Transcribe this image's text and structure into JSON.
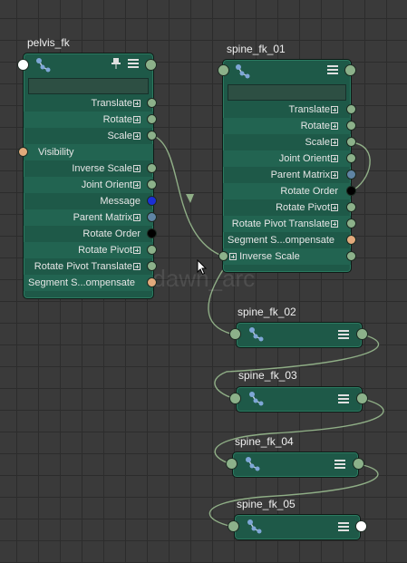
{
  "nodes": {
    "pelvis": {
      "title": "pelvis_fk",
      "rows": [
        "Translate",
        "Rotate",
        "Scale",
        "Visibility",
        "Inverse Scale",
        "Joint Orient",
        "Message",
        "Parent Matrix",
        "Rotate Order",
        "Rotate Pivot",
        "Rotate Pivot Translate",
        "Segment S...ompensate"
      ]
    },
    "spine01": {
      "title": "spine_fk_01",
      "rows": [
        "Translate",
        "Rotate",
        "Scale",
        "Joint Orient",
        "Parent Matrix",
        "Rotate Order",
        "Rotate Pivot",
        "Rotate Pivot Translate",
        "Segment S...ompensate",
        "Inverse Scale"
      ]
    },
    "spine02": {
      "title": "spine_fk_02"
    },
    "spine03": {
      "title": "spine_fk_03"
    },
    "spine04": {
      "title": "spine_fk_04"
    },
    "spine05": {
      "title": "spine_fk_05"
    }
  },
  "watermark": "@dawn_arc",
  "icons": [
    "joint-icon",
    "menu-icon",
    "pin-icon",
    "expand-icon",
    "cursor-icon"
  ],
  "colors": {
    "node_body": "#1e5948",
    "node_row_alt": "#226451",
    "wire": "#8fae86",
    "port_output": "#8cb18a",
    "port_message": "#1b2fd6",
    "port_matrix": "#5f84a4",
    "port_enum": "#000000",
    "port_bool": "#e2aa7c"
  }
}
